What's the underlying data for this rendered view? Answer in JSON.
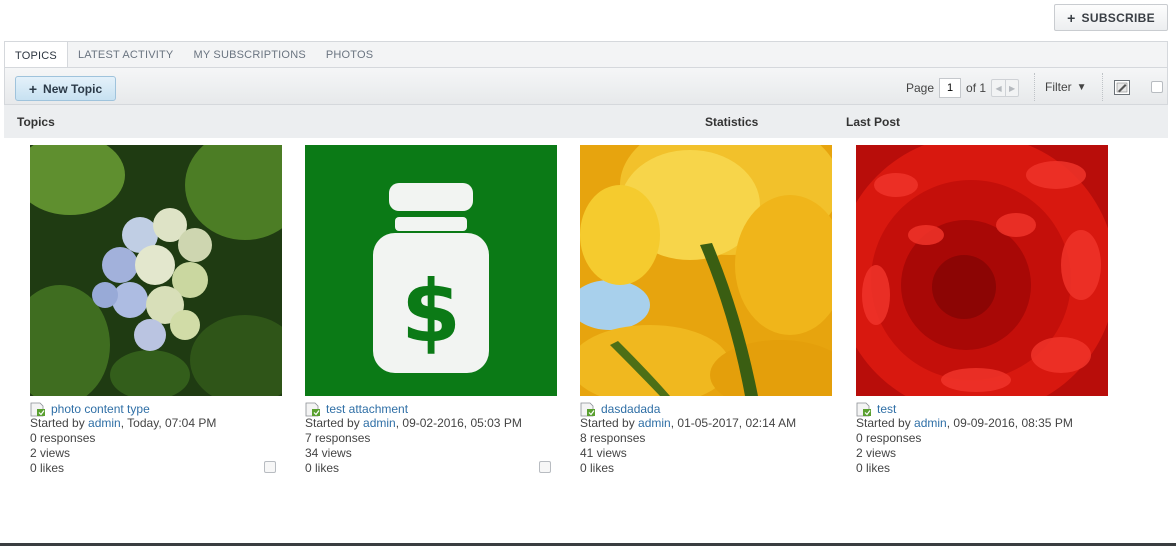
{
  "header": {
    "subscribe_label": "SUBSCRIBE"
  },
  "tabs": [
    {
      "label": "TOPICS",
      "active": true
    },
    {
      "label": "LATEST ACTIVITY",
      "active": false
    },
    {
      "label": "MY SUBSCRIPTIONS",
      "active": false
    },
    {
      "label": "PHOTOS",
      "active": false
    }
  ],
  "toolbar": {
    "new_topic_label": "New Topic",
    "page_label": "Page",
    "page_value": "1",
    "of_label": "of 1",
    "filter_label": "Filter"
  },
  "columns": {
    "topics": "Topics",
    "statistics": "Statistics",
    "last_post": "Last Post"
  },
  "cards": [
    {
      "title": "photo content type",
      "started_by": "Started by",
      "author": "admin",
      "date": ", Today, 07:04 PM",
      "responses": "0 responses",
      "views": "2 views",
      "likes": "0 likes",
      "image": "hydrangea-photo"
    },
    {
      "title": "test attachment",
      "started_by": "Started by",
      "author": "admin",
      "date": ", 09-02-2016, 05:03 PM",
      "responses": "7 responses",
      "views": "34 views",
      "likes": "0 likes",
      "image": "money-jar-icon"
    },
    {
      "title": "dasdadada",
      "started_by": "Started by",
      "author": "admin",
      "date": ", 01-05-2017, 02:14 AM",
      "responses": "8 responses",
      "views": "41 views",
      "likes": "0 likes",
      "image": "yellow-tulips-photo"
    },
    {
      "title": "test",
      "started_by": "Started by",
      "author": "admin",
      "date": ", 09-09-2016, 08:35 PM",
      "responses": "0 responses",
      "views": "2 views",
      "likes": "0 likes",
      "image": "red-chrysanthemum-photo"
    }
  ],
  "colors": {
    "link": "#2f6fa6",
    "jar_green": "#0b7a16"
  }
}
